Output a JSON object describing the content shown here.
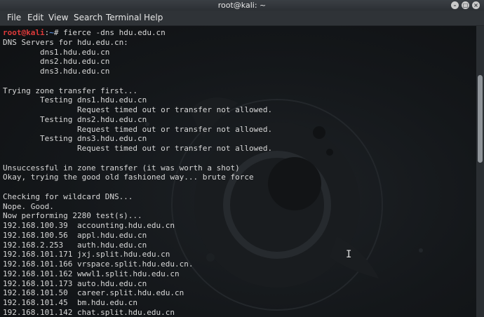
{
  "window": {
    "title": "root@kali: ~",
    "controls": [
      "minimize",
      "maximize",
      "close"
    ]
  },
  "menu": [
    "File",
    "Edit",
    "View",
    "Search",
    "Terminal",
    "Help"
  ],
  "terminal": {
    "prompt": {
      "user": "root@kali",
      "sep": ":",
      "path": "~",
      "symbol": "# "
    },
    "command": "fierce -dns hdu.edu.cn",
    "output": [
      "DNS Servers for hdu.edu.cn:",
      "        dns1.hdu.edu.cn",
      "        dns2.hdu.edu.cn",
      "        dns3.hdu.edu.cn",
      "",
      "Trying zone transfer first...",
      "        Testing dns1.hdu.edu.cn",
      "                Request timed out or transfer not allowed.",
      "        Testing dns2.hdu.edu.cn",
      "                Request timed out or transfer not allowed.",
      "        Testing dns3.hdu.edu.cn",
      "                Request timed out or transfer not allowed.",
      "",
      "Unsuccessful in zone transfer (it was worth a shot)",
      "Okay, trying the good old fashioned way... brute force",
      "",
      "Checking for wildcard DNS...",
      "Nope. Good.",
      "Now performing 2280 test(s)...",
      "192.168.100.39  accounting.hdu.edu.cn",
      "192.168.100.56  appl.hdu.edu.cn",
      "192.168.2.253   auth.hdu.edu.cn",
      "192.168.101.171 jxj.split.hdu.edu.cn",
      "192.168.101.166 vrspace.split.hdu.edu.cn.",
      "192.168.101.162 wwwl1.split.hdu.edu.cn",
      "192.168.101.173 auto.hdu.edu.cn",
      "192.168.101.50  career.split.hdu.edu.cn",
      "192.168.101.45  bm.hdu.edu.cn",
      "192.168.101.142 chat.split.hdu.edu.cn"
    ]
  },
  "icons": {
    "minimize": "minimize-icon",
    "maximize": "maximize-icon",
    "close": "close-icon",
    "text_cursor": "i-beam-cursor-icon"
  },
  "colors": {
    "prompt_user": "#e03a3a",
    "prompt_path": "#5b8fd9",
    "text": "#d8d8d8",
    "background": "#14171a"
  }
}
